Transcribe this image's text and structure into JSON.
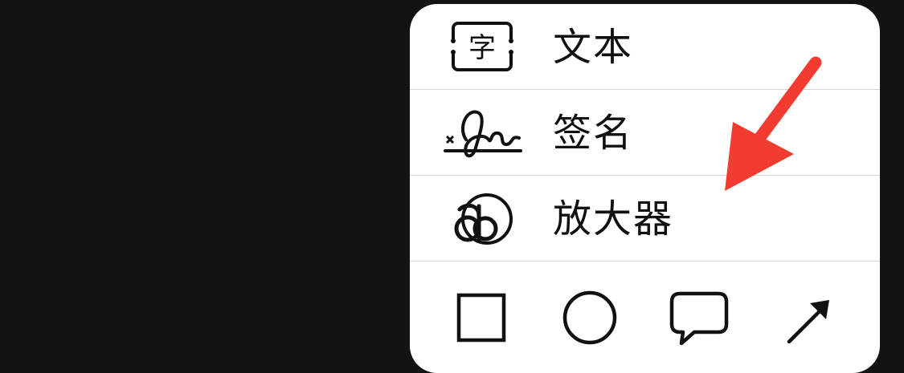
{
  "menu": {
    "items": [
      {
        "label": "文本",
        "icon": "text-box-icon",
        "glyph": "字"
      },
      {
        "label": "签名",
        "icon": "signature-icon"
      },
      {
        "label": "放大器",
        "icon": "magnifier-icon"
      }
    ],
    "shapes": [
      {
        "icon": "square-icon"
      },
      {
        "icon": "circle-icon"
      },
      {
        "icon": "speech-bubble-icon"
      },
      {
        "icon": "arrow-icon"
      }
    ]
  },
  "annotation": {
    "color": "#f23c32"
  },
  "colors": {
    "background": "#121313",
    "menu": "#ffffff",
    "divider": "#d6d6d6",
    "text": "#111111"
  }
}
